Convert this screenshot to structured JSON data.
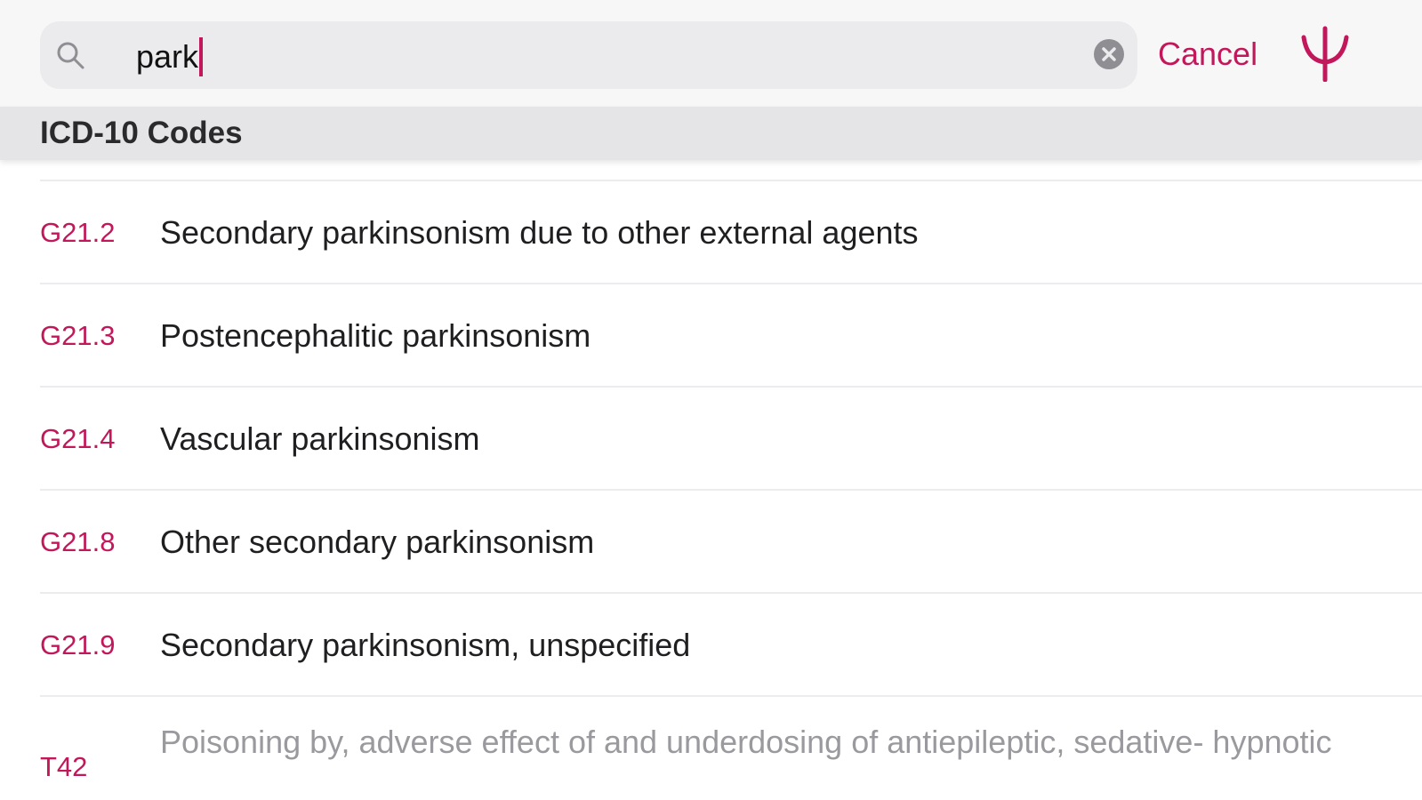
{
  "search": {
    "value": "park",
    "cancel_label": "Cancel"
  },
  "section": {
    "title": "ICD-10 Codes"
  },
  "results": [
    {
      "code": "G21.2",
      "description": "Secondary parkinsonism due to other external agents"
    },
    {
      "code": "G21.3",
      "description": "Postencephalitic parkinsonism"
    },
    {
      "code": "G21.4",
      "description": "Vascular parkinsonism"
    },
    {
      "code": "G21.8",
      "description": "Other secondary parkinsonism"
    },
    {
      "code": "G21.9",
      "description": "Secondary parkinsonism, unspecified"
    },
    {
      "code": "T42",
      "description": "Poisoning by, adverse effect of and underdosing of antiepileptic, sedative- hypnotic"
    }
  ],
  "colors": {
    "accent": "#c2185b",
    "search_bg": "#ebebed",
    "section_bg": "#e5e5e7"
  },
  "icons": [
    "search-icon",
    "clear-icon",
    "psi-logo-icon"
  ]
}
